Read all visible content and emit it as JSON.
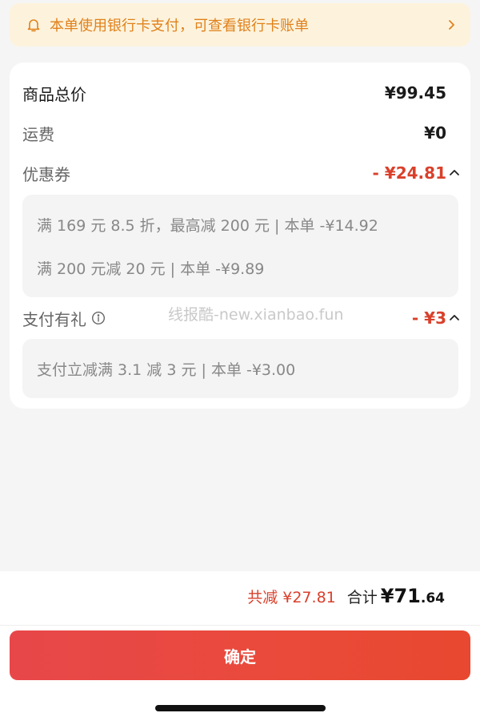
{
  "notice": {
    "text": "本单使用银行卡支付，可查看银行卡账单",
    "icon": "bell-icon",
    "color": "#e0811b"
  },
  "summary": {
    "goods_total": {
      "label": "商品总价",
      "value": "¥99.45"
    },
    "shipping": {
      "label": "运费",
      "value": "¥0"
    },
    "coupon": {
      "label": "优惠券",
      "value": "- ¥24.81",
      "details": [
        "满 169 元 8.5 折，最高减 200 元 | 本单 -¥14.92",
        "满 200 元减 20 元 | 本单 -¥9.89"
      ]
    },
    "payment_gift": {
      "label": "支付有礼",
      "value": "- ¥3",
      "details": [
        "支付立减满 3.1 减 3 元 | 本单 -¥3.00"
      ]
    }
  },
  "watermark": "线报酷-new.xianbao.fun",
  "footer": {
    "total_reduce": "共减 ¥27.81",
    "total_label": "合计",
    "total_int": "¥71",
    "total_dec": ".64",
    "confirm_label": "确定"
  },
  "colors": {
    "accent_red": "#d9402b",
    "button_start": "#e8474a",
    "button_end": "#e8482f"
  }
}
